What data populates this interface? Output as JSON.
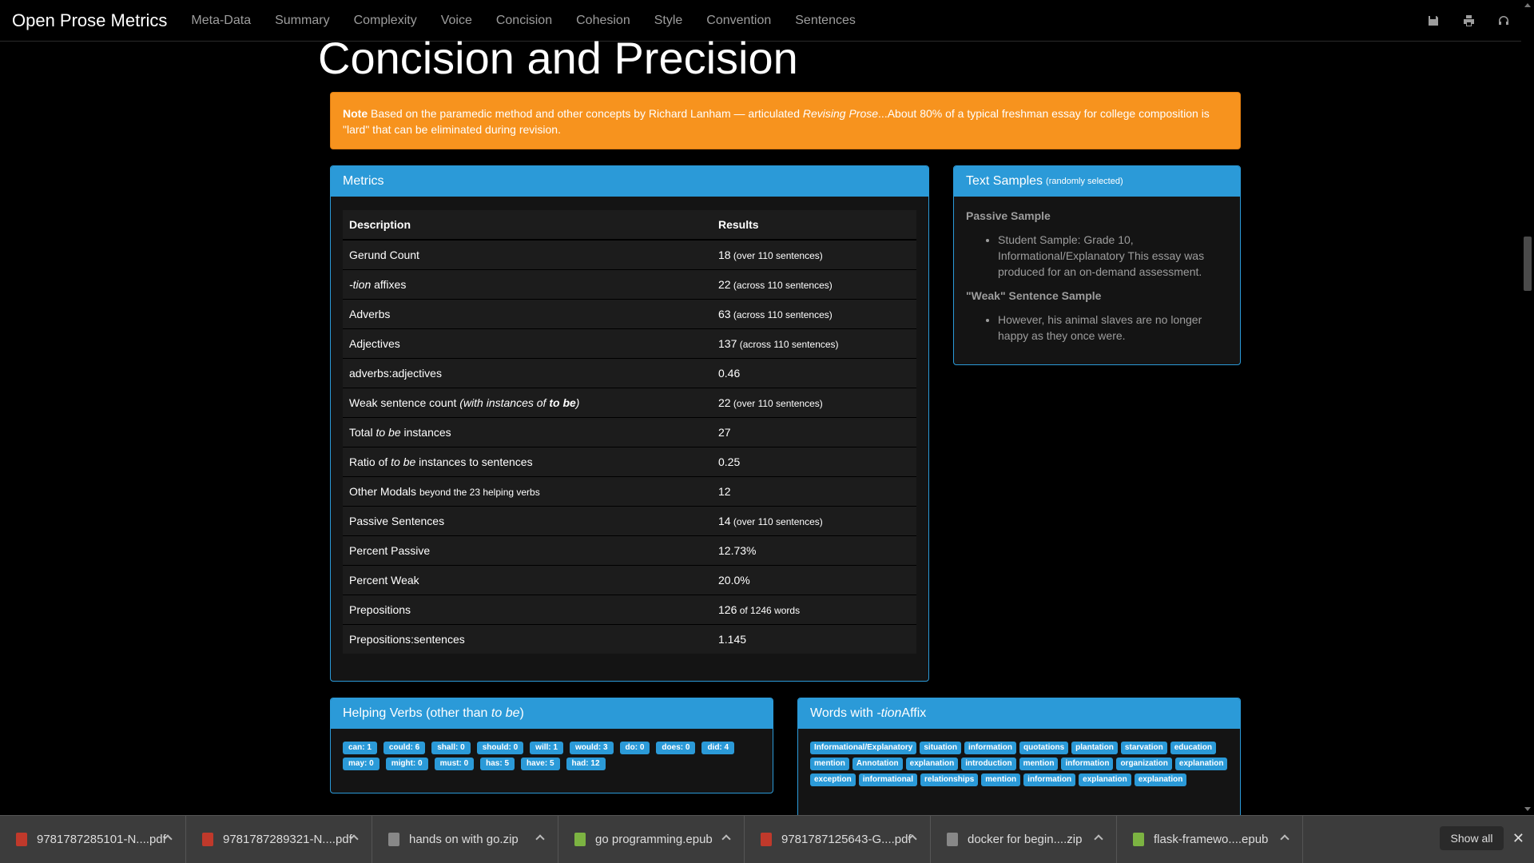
{
  "navbar": {
    "brand": "Open Prose Metrics",
    "items": [
      "Meta-Data",
      "Summary",
      "Complexity",
      "Voice",
      "Concision",
      "Cohesion",
      "Style",
      "Convention",
      "Sentences"
    ],
    "icons": [
      "save-icon",
      "print-icon",
      "headphones-icon"
    ]
  },
  "page_title": "Concision and Precision",
  "note": {
    "label": "Note",
    "text1": " Based on the paramedic method and other concepts by Richard Lanham — articulated ",
    "italic": "Revising Prose",
    "text2": "...About 80% of a typical freshman essay for college composition is \"lard\" that can be eliminated during revision."
  },
  "metrics": {
    "heading": "Metrics",
    "headers": [
      "Description",
      "Results"
    ],
    "rows": [
      {
        "pre": "Gerund Count",
        "value": "18",
        "small": " (over 110 sentences)"
      },
      {
        "pre": "",
        "em": "-tion",
        "post": " affixes",
        "value": "22",
        "small": " (across 110 sentences)"
      },
      {
        "pre": "Adverbs",
        "value": "63",
        "small": " (across 110 sentences)"
      },
      {
        "pre": "Adjectives",
        "value": "137",
        "small": " (across 110 sentences)"
      },
      {
        "pre": "adverbs:adjectives",
        "value": "0.46"
      },
      {
        "pre": "Weak sentence count ",
        "em": "(with instances of ",
        "strongem": "to be",
        "em2": ")",
        "value": "22",
        "small": " (over 110 sentences)"
      },
      {
        "pre": "Total ",
        "em": "to be",
        "post": " instances",
        "value": "27"
      },
      {
        "pre": "Ratio of ",
        "em": "to be",
        "post": " instances to sentences",
        "value": "0.25"
      },
      {
        "pre": "Other Modals ",
        "smalldesc": "beyond the 23 helping verbs",
        "value": "12"
      },
      {
        "pre": "Passive Sentences",
        "value": "14",
        "small": " (over 110 sentences)"
      },
      {
        "pre": "Percent Passive",
        "value": "12.73%"
      },
      {
        "pre": "Percent Weak",
        "value": "20.0%"
      },
      {
        "pre": "Prepositions",
        "value": "126",
        "small": " of 1246 words"
      },
      {
        "pre": "Prepositions:sentences",
        "value": "1.145"
      }
    ]
  },
  "samples": {
    "heading": "Text Samples",
    "heading_small": "(randomly selected)",
    "passive_title": "Passive Sample",
    "passive_text": " Student Sample: Grade 10, Informational/Explanatory This essay was produced for an on-demand assessment.",
    "weak_title": "\"Weak\" Sentence Sample",
    "weak_text": "However, his animal slaves are no longer happy as they once were."
  },
  "helping": {
    "heading_pre": "Helping Verbs (other than ",
    "heading_em": "to be",
    "heading_post": ")",
    "tags": [
      "can: 1",
      "could: 6",
      "shall: 0",
      "should: 0",
      "will: 1",
      "would: 3",
      "do: 0",
      "does: 0",
      "did: 4",
      "may: 0",
      "might: 0",
      "must: 0",
      "has: 5",
      "have: 5",
      "had: 12"
    ]
  },
  "tion": {
    "heading_pre": "Words with ",
    "heading_em": "-tion",
    "heading_post": " Affix",
    "tags": [
      "Informational/Explanatory",
      "situation",
      "information",
      "quotations",
      "plantation",
      "starvation",
      "education",
      "mention",
      "Annotation",
      "explanation",
      "introduction",
      "mention",
      "information",
      "organization",
      "explanation",
      "exception",
      "informational",
      "relationships",
      "mention",
      "information",
      "explanation",
      "explanation"
    ]
  },
  "downloads": {
    "items": [
      {
        "name": "9781787285101-N....pdf",
        "type": "pdf"
      },
      {
        "name": "9781787289321-N....pdf",
        "type": "pdf"
      },
      {
        "name": "hands on with go.zip",
        "type": "zip"
      },
      {
        "name": "go programming.epub",
        "type": "epub"
      },
      {
        "name": "9781787125643-G....pdf",
        "type": "pdf"
      },
      {
        "name": "docker for begin....zip",
        "type": "zip"
      },
      {
        "name": "flask-framewo....epub",
        "type": "epub"
      }
    ],
    "show_all": "Show all",
    "colors": {
      "pdf": "#c0392b",
      "zip": "#888888",
      "epub": "#7cb342"
    }
  }
}
